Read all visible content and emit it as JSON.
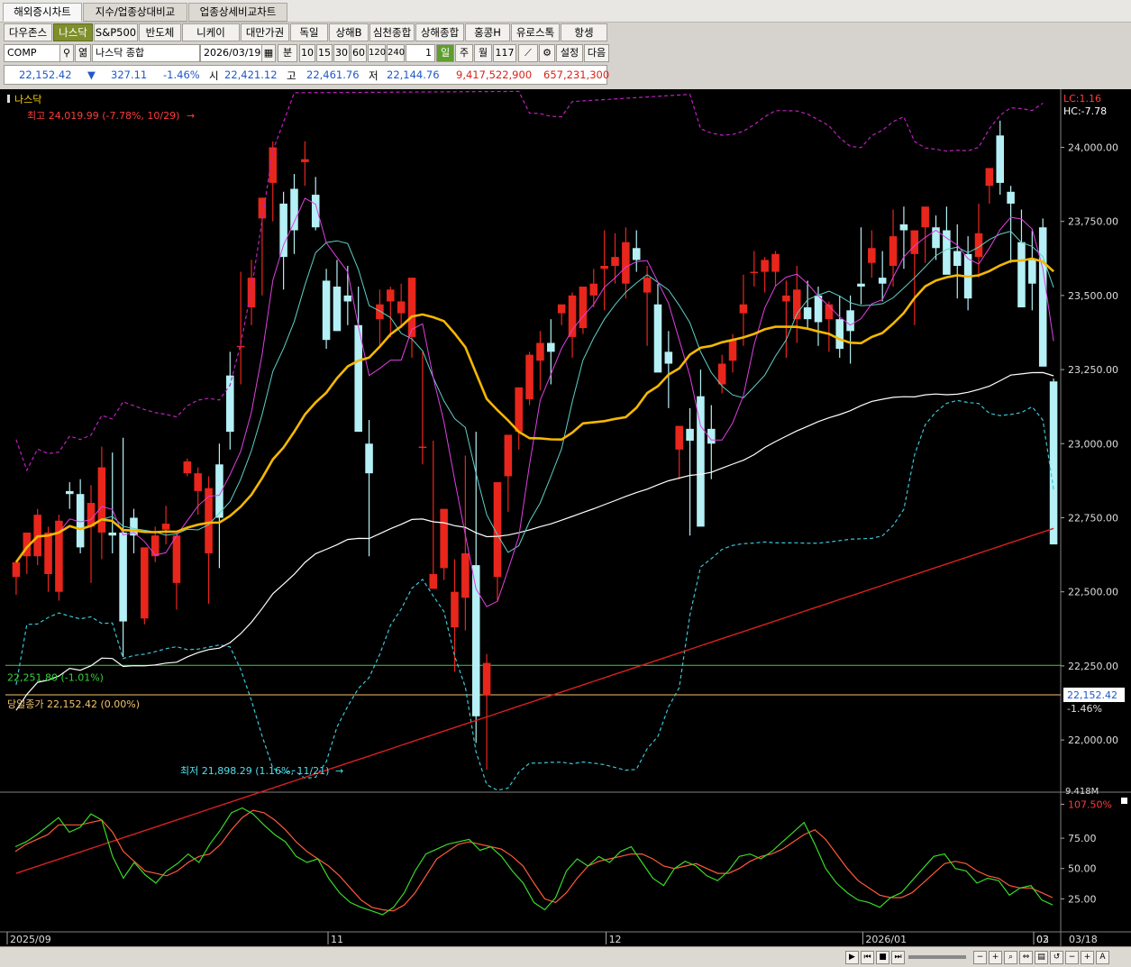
{
  "tabs": [
    "해외증시차트",
    "지수/업종상대비교",
    "업종상세비교차트"
  ],
  "markets": [
    "다우존스",
    "나스닥",
    "S&P500",
    "반도체",
    "니케이",
    "대만가권",
    "독일",
    "상해B",
    "심천종합",
    "상해종합",
    "홍콩H",
    "유로스톡",
    "항셍"
  ],
  "controls": {
    "symbol": "COMP",
    "symbol_name": "나스닥 종합",
    "date": "2026/03/19",
    "period_label": "분",
    "minute_options": [
      "10",
      "15",
      "30",
      "60",
      "120",
      "240"
    ],
    "count": "1",
    "daily": "일",
    "weekly": "주",
    "monthly": "월",
    "bars": "117",
    "settings": "설정",
    "next": "다음"
  },
  "quote": {
    "last": "22,152.42",
    "arrow": "▼",
    "change": "327.11",
    "change_pct": "-1.46%",
    "open_label": "시",
    "open": "22,421.12",
    "high_label": "고",
    "high": "22,461.76",
    "low_label": "저",
    "low": "22,144.76",
    "volume": "9,417,522,900",
    "amount": "657,231,300"
  },
  "colors": {
    "up": "#e8261c",
    "down": "#b4f0f5",
    "ma20": "#f5b800",
    "ma60": "#ffffff",
    "ma120": "#d62020",
    "stoch_k": "#39d928",
    "stoch_d": "#ff5a3a",
    "bollinger": "#c020c0"
  },
  "chart_data": {
    "type": "candlestick",
    "title": "나스닥",
    "price_axis": {
      "ticks": [
        "24,000.00",
        "23,750.00",
        "23,500.00",
        "23,250.00",
        "23,000.00",
        "22,750.00",
        "22,500.00",
        "22,250.00",
        "22,000.00"
      ],
      "range": [
        21830,
        24190
      ]
    },
    "time_axis": [
      "2025/09",
      "11",
      "12",
      "2026/01",
      "02",
      "03",
      "03/18"
    ],
    "annotations": {
      "high": "최고 24,019.99 (-7.78%, 10/29)",
      "low": "최저 21,898.29 (1.16%, 11/21)",
      "hline_green": "22,251.80 (-1.01%)",
      "hline_close": "당일종가 22,152.42 (0.00%)",
      "price_tag": "22,152.42",
      "price_tag_pct": "-1.46%",
      "lc": "LC:1.16",
      "hc": "HC:-7.78",
      "volume_label": "9.418M"
    },
    "candles": [
      {
        "o": 22550,
        "h": 22600,
        "l": 22490,
        "c": 22600
      },
      {
        "o": 22620,
        "h": 22700,
        "l": 22560,
        "c": 22700
      },
      {
        "o": 22620,
        "h": 22780,
        "l": 22590,
        "c": 22760
      },
      {
        "o": 22560,
        "h": 22720,
        "l": 22500,
        "c": 22700
      },
      {
        "o": 22500,
        "h": 22760,
        "l": 22470,
        "c": 22740
      },
      {
        "o": 22840,
        "h": 22870,
        "l": 22780,
        "c": 22830
      },
      {
        "o": 22830,
        "h": 22880,
        "l": 22630,
        "c": 22650
      },
      {
        "o": 22720,
        "h": 22860,
        "l": 22530,
        "c": 22800
      },
      {
        "o": 22700,
        "h": 22990,
        "l": 22610,
        "c": 22920
      },
      {
        "o": 22700,
        "h": 22970,
        "l": 22630,
        "c": 22690
      },
      {
        "o": 22700,
        "h": 23020,
        "l": 22280,
        "c": 22400
      },
      {
        "o": 22750,
        "h": 22780,
        "l": 22630,
        "c": 22690
      },
      {
        "o": 22410,
        "h": 22550,
        "l": 22390,
        "c": 22650
      },
      {
        "o": 22620,
        "h": 22720,
        "l": 22600,
        "c": 22690
      },
      {
        "o": 22710,
        "h": 22790,
        "l": 22660,
        "c": 22730
      },
      {
        "o": 22530,
        "h": 22620,
        "l": 22440,
        "c": 22690
      },
      {
        "o": 22900,
        "h": 22950,
        "l": 22890,
        "c": 22940
      },
      {
        "o": 22840,
        "h": 22920,
        "l": 22760,
        "c": 22900
      },
      {
        "o": 22630,
        "h": 22890,
        "l": 22460,
        "c": 22850
      },
      {
        "o": 22930,
        "h": 23000,
        "l": 22580,
        "c": 22750
      },
      {
        "o": 23230,
        "h": 23310,
        "l": 22980,
        "c": 23040
      },
      {
        "o": 23330,
        "h": 23580,
        "l": 23200,
        "c": 23330
      },
      {
        "o": 23460,
        "h": 23620,
        "l": 23400,
        "c": 23560
      },
      {
        "o": 23760,
        "h": 23820,
        "l": 23500,
        "c": 23830
      },
      {
        "o": 23880,
        "h": 24020,
        "l": 23750,
        "c": 24000
      },
      {
        "o": 23810,
        "h": 23850,
        "l": 23520,
        "c": 23630
      },
      {
        "o": 23860,
        "h": 23910,
        "l": 23640,
        "c": 23720
      },
      {
        "o": 23950,
        "h": 24020,
        "l": 23870,
        "c": 23960
      },
      {
        "o": 23840,
        "h": 23900,
        "l": 23720,
        "c": 23730
      },
      {
        "o": 23550,
        "h": 23590,
        "l": 23320,
        "c": 23350
      },
      {
        "o": 23530,
        "h": 23620,
        "l": 23380,
        "c": 23380
      },
      {
        "o": 23500,
        "h": 23600,
        "l": 23400,
        "c": 23480
      },
      {
        "o": 23400,
        "h": 23530,
        "l": 23120,
        "c": 23040
      },
      {
        "o": 23000,
        "h": 23080,
        "l": 22620,
        "c": 22900
      },
      {
        "o": 23420,
        "h": 23520,
        "l": 23330,
        "c": 23470
      },
      {
        "o": 23480,
        "h": 23530,
        "l": 23360,
        "c": 23520
      },
      {
        "o": 23440,
        "h": 23540,
        "l": 23390,
        "c": 23480
      },
      {
        "o": 23360,
        "h": 23560,
        "l": 23290,
        "c": 23560
      },
      {
        "o": 22990,
        "h": 23310,
        "l": 22930,
        "c": 22990
      },
      {
        "o": 22510,
        "h": 23010,
        "l": 22520,
        "c": 22560
      },
      {
        "o": 22580,
        "h": 22740,
        "l": 22540,
        "c": 22780
      },
      {
        "o": 22380,
        "h": 22610,
        "l": 22230,
        "c": 22500
      },
      {
        "o": 22480,
        "h": 22960,
        "l": 22370,
        "c": 22630
      },
      {
        "o": 22590,
        "h": 23040,
        "l": 21990,
        "c": 22080
      },
      {
        "o": 22150,
        "h": 22290,
        "l": 21900,
        "c": 22260
      },
      {
        "o": 22550,
        "h": 22780,
        "l": 22470,
        "c": 22870
      },
      {
        "o": 22890,
        "h": 22990,
        "l": 22770,
        "c": 23030
      },
      {
        "o": 23040,
        "h": 23190,
        "l": 22980,
        "c": 23190
      },
      {
        "o": 23150,
        "h": 23310,
        "l": 23130,
        "c": 23300
      },
      {
        "o": 23280,
        "h": 23380,
        "l": 23180,
        "c": 23340
      },
      {
        "o": 23340,
        "h": 23420,
        "l": 23200,
        "c": 23310
      },
      {
        "o": 23440,
        "h": 23460,
        "l": 23400,
        "c": 23470
      },
      {
        "o": 23360,
        "h": 23510,
        "l": 23290,
        "c": 23500
      },
      {
        "o": 23390,
        "h": 23520,
        "l": 23370,
        "c": 23530
      },
      {
        "o": 23500,
        "h": 23590,
        "l": 23460,
        "c": 23540
      },
      {
        "o": 23590,
        "h": 23720,
        "l": 23450,
        "c": 23600
      },
      {
        "o": 23600,
        "h": 23710,
        "l": 23540,
        "c": 23630
      },
      {
        "o": 23540,
        "h": 23730,
        "l": 23490,
        "c": 23680
      },
      {
        "o": 23660,
        "h": 23720,
        "l": 23580,
        "c": 23620
      },
      {
        "o": 23510,
        "h": 23600,
        "l": 23330,
        "c": 23560
      },
      {
        "o": 23470,
        "h": 23540,
        "l": 23250,
        "c": 23240
      },
      {
        "o": 23310,
        "h": 23380,
        "l": 23120,
        "c": 23270
      },
      {
        "o": 22980,
        "h": 23030,
        "l": 22880,
        "c": 23060
      },
      {
        "o": 23050,
        "h": 23120,
        "l": 22690,
        "c": 23010
      },
      {
        "o": 23160,
        "h": 23250,
        "l": 22730,
        "c": 22720
      },
      {
        "o": 23050,
        "h": 23130,
        "l": 22880,
        "c": 23000
      },
      {
        "o": 23200,
        "h": 23300,
        "l": 23170,
        "c": 23270
      },
      {
        "o": 23280,
        "h": 23370,
        "l": 23240,
        "c": 23350
      },
      {
        "o": 23440,
        "h": 23570,
        "l": 23330,
        "c": 23470
      },
      {
        "o": 23580,
        "h": 23650,
        "l": 23530,
        "c": 23580
      },
      {
        "o": 23580,
        "h": 23630,
        "l": 23510,
        "c": 23620
      },
      {
        "o": 23580,
        "h": 23650,
        "l": 23530,
        "c": 23640
      },
      {
        "o": 23480,
        "h": 23550,
        "l": 23290,
        "c": 23500
      },
      {
        "o": 23420,
        "h": 23600,
        "l": 23340,
        "c": 23520
      },
      {
        "o": 23460,
        "h": 23550,
        "l": 23390,
        "c": 23420
      },
      {
        "o": 23500,
        "h": 23530,
        "l": 23330,
        "c": 23410
      },
      {
        "o": 23420,
        "h": 23480,
        "l": 23310,
        "c": 23470
      },
      {
        "o": 23420,
        "h": 23500,
        "l": 23290,
        "c": 23320
      },
      {
        "o": 23450,
        "h": 23500,
        "l": 23270,
        "c": 23380
      },
      {
        "o": 23540,
        "h": 23730,
        "l": 23470,
        "c": 23530
      },
      {
        "o": 23610,
        "h": 23720,
        "l": 23560,
        "c": 23660
      },
      {
        "o": 23560,
        "h": 23650,
        "l": 23480,
        "c": 23540
      },
      {
        "o": 23600,
        "h": 23790,
        "l": 23530,
        "c": 23700
      },
      {
        "o": 23740,
        "h": 23800,
        "l": 23590,
        "c": 23720
      },
      {
        "o": 23640,
        "h": 23700,
        "l": 23400,
        "c": 23720
      },
      {
        "o": 23730,
        "h": 23790,
        "l": 23610,
        "c": 23800
      },
      {
        "o": 23730,
        "h": 23770,
        "l": 23620,
        "c": 23660
      },
      {
        "o": 23720,
        "h": 23800,
        "l": 23580,
        "c": 23570
      },
      {
        "o": 23650,
        "h": 23740,
        "l": 23490,
        "c": 23600
      },
      {
        "o": 23640,
        "h": 23700,
        "l": 23450,
        "c": 23490
      },
      {
        "o": 23630,
        "h": 23810,
        "l": 23560,
        "c": 23710
      },
      {
        "o": 23870,
        "h": 23930,
        "l": 23810,
        "c": 23930
      },
      {
        "o": 24040,
        "h": 24090,
        "l": 23840,
        "c": 23880
      },
      {
        "o": 23850,
        "h": 23870,
        "l": 23610,
        "c": 23810
      },
      {
        "o": 23680,
        "h": 23790,
        "l": 23610,
        "c": 23460
      },
      {
        "o": 23620,
        "h": 23720,
        "l": 23450,
        "c": 23540
      },
      {
        "o": 23730,
        "h": 23760,
        "l": 23290,
        "c": 23260
      },
      {
        "o": 23210,
        "h": 23220,
        "l": 22960,
        "c": 22660
      }
    ],
    "stochastic": {
      "axis": [
        "107.50%",
        "75.00",
        "50.00",
        "25.00"
      ],
      "range": [
        0,
        110
      ],
      "k": [
        68,
        72,
        78,
        85,
        92,
        80,
        84,
        95,
        90,
        60,
        42,
        55,
        45,
        38,
        48,
        54,
        62,
        55,
        70,
        82,
        96,
        100,
        95,
        86,
        78,
        72,
        60,
        55,
        58,
        42,
        30,
        22,
        18,
        15,
        12,
        18,
        30,
        48,
        62,
        66,
        70,
        72,
        74,
        65,
        68,
        60,
        48,
        38,
        22,
        16,
        26,
        48,
        58,
        52,
        60,
        55,
        64,
        68,
        55,
        42,
        36,
        50,
        56,
        52,
        44,
        40,
        48,
        60,
        62,
        58,
        64,
        72,
        80,
        88,
        70,
        50,
        38,
        30,
        24,
        22,
        18,
        26,
        30,
        40,
        50,
        60,
        62,
        50,
        48,
        38,
        42,
        40,
        28,
        34,
        36,
        24,
        20
      ],
      "d": [
        64,
        70,
        74,
        78,
        86,
        86,
        86,
        88,
        90,
        80,
        64,
        56,
        48,
        46,
        44,
        48,
        55,
        60,
        62,
        70,
        82,
        92,
        98,
        96,
        90,
        82,
        72,
        64,
        58,
        52,
        44,
        34,
        24,
        18,
        16,
        15,
        20,
        30,
        44,
        58,
        64,
        70,
        72,
        70,
        68,
        66,
        60,
        52,
        38,
        25,
        22,
        30,
        42,
        52,
        56,
        58,
        60,
        62,
        62,
        58,
        52,
        50,
        52,
        54,
        50,
        46,
        46,
        50,
        56,
        60,
        62,
        66,
        72,
        78,
        82,
        74,
        62,
        50,
        40,
        34,
        28,
        26,
        26,
        30,
        38,
        46,
        54,
        56,
        54,
        48,
        44,
        42,
        36,
        34,
        34,
        30,
        26
      ]
    }
  }
}
